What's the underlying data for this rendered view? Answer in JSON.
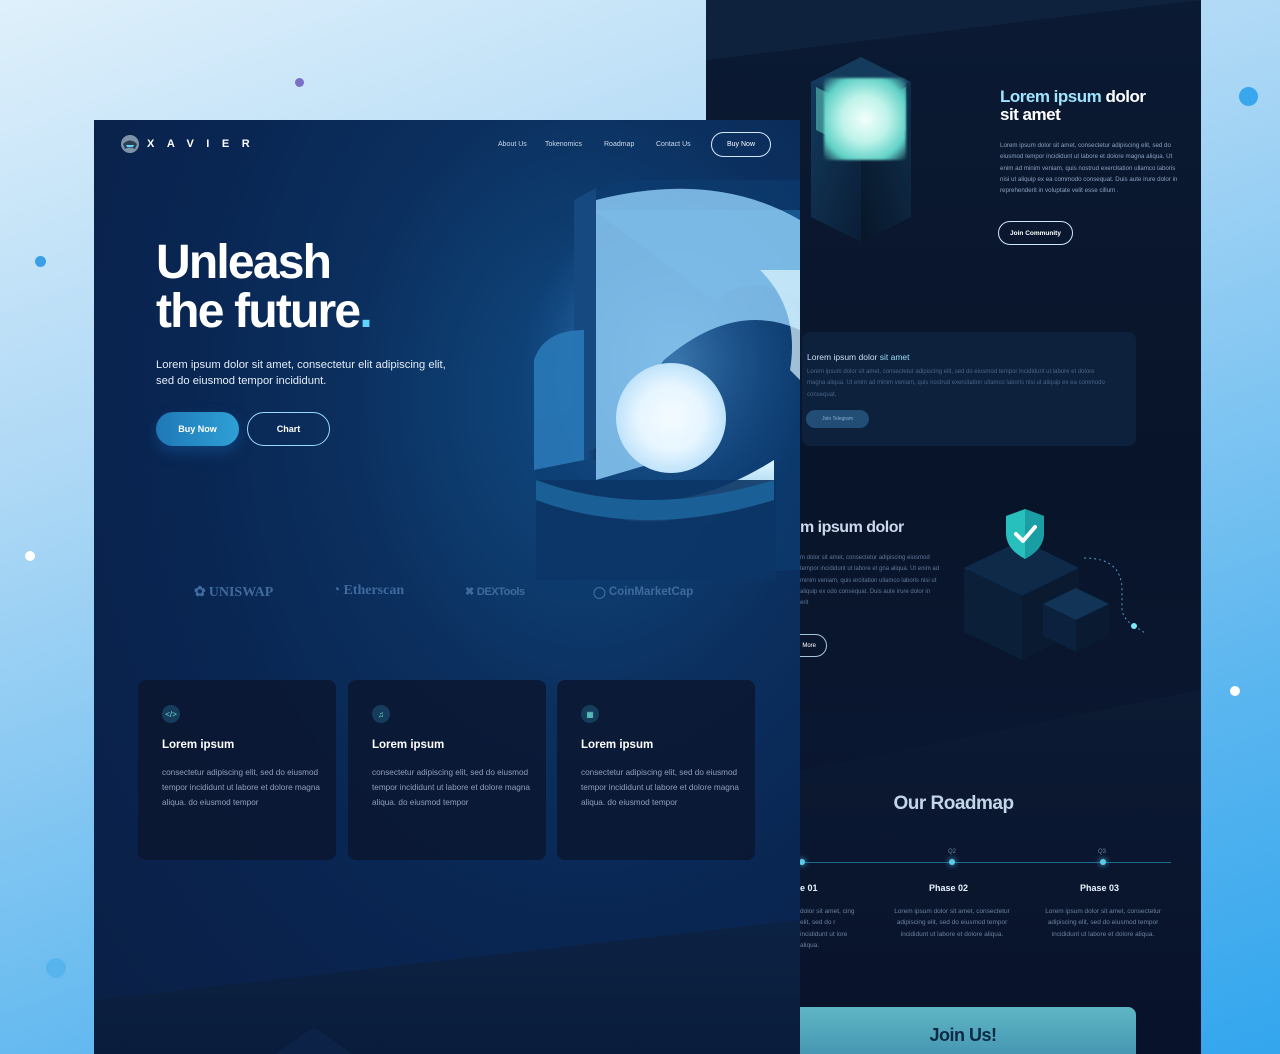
{
  "brand": {
    "name": "XAVIER"
  },
  "nav": {
    "items": [
      "About Us",
      "Tokenomics",
      "Roadmap",
      "Contact Us"
    ],
    "cta": "Buy Now"
  },
  "hero": {
    "title_line1": "Unleash",
    "title_line2": "the future",
    "title_dot": ".",
    "subtitle": "Lorem ipsum dolor sit amet, consectetur elit adipiscing elit, sed do eiusmod tempor incididunt.",
    "primary_button": "Buy Now",
    "secondary_button": "Chart"
  },
  "partners": [
    {
      "name": "UNISWAP",
      "icon": "uniswap-icon"
    },
    {
      "name": "Etherscan",
      "icon": "etherscan-icon"
    },
    {
      "name": "DEXTools",
      "icon": "dextools-icon"
    },
    {
      "name": "CoinMarketCap",
      "icon": "coinmarketcap-icon"
    }
  ],
  "features": [
    {
      "icon": "code-icon",
      "title": "Lorem ipsum",
      "text": "consectetur adipiscing elit, sed do eiusmod tempor incididunt ut  labore et dolore magna aliqua. do eiusmod tempor"
    },
    {
      "icon": "music-note-icon",
      "title": "Lorem ipsum",
      "text": "consectetur adipiscing elit, sed do eiusmod tempor incididunt ut  labore et dolore magna aliqua. do eiusmod tempor"
    },
    {
      "icon": "network-icon",
      "title": "Lorem ipsum",
      "text": "consectetur adipiscing elit, sed do eiusmod tempor incididunt ut  labore et dolore magna aliqua. do eiusmod tempor"
    }
  ],
  "about": {
    "title_highlight": "Lorem ipsum",
    "title_rest1": "dolor",
    "title_line2": "sit amet",
    "text": "Lorem ipsum dolor sit amet, consectetur adipiscing elit, sed do eiusmod tempor incididunt ut labore et dolore magna aliqua. Ut enim ad minim veniam, quis nostrud exercitation ullamco laboris nisi ut aliquip ex ea commodo consequat. Duis aute irure dolor in reprehenderit in voluptate velit esse cillum .",
    "button": "Join Community"
  },
  "telegram_card": {
    "title_a": "Lorem ipsum dolor",
    "title_b": "sit amet",
    "text": "Lorem ipsum dolor sit amet, consectetur adipiscing elit, sed do eiusmod tempor incididunt ut labore et dolore magna aliqua. Ut enim ad minim veniam, quis nostrud exercitation ullamco laboris nisi ut aliquip ex ea commodo consequat.",
    "button": "Join Telegram"
  },
  "security": {
    "title": "m ipsum dolor",
    "text": "m dolor sit amet, consectetur adipiscing eiusmod tempor incididunt ut labore et gna aliqua. Ut enim ad minim veniam, quis ercitation ullamco laboris nisi ut aliquip ex odo consequat. Duis aute irure dolor in erit",
    "button": "More"
  },
  "roadmap": {
    "title": "Our Roadmap",
    "phases": [
      {
        "q": "",
        "name": "e 01",
        "text": "dolor sit amet, cing elit, sed do r incididunt ut lore aliqua."
      },
      {
        "q": "Q2",
        "name": "Phase 02",
        "text": "Lorem ipsum dolor sit amet, consectetur adipiscing elit, sed do eiusmod tempor incididunt ut labore et dolore aliqua."
      },
      {
        "q": "Q3",
        "name": "Phase 03",
        "text": "Lorem ipsum dolor sit amet, consectetur adipiscing elit, sed do eiusmod tempor incididunt ut labore et dolore aliqua."
      }
    ]
  },
  "join": {
    "title": "Join Us!"
  },
  "colors": {
    "accent": "#5fd4ff",
    "panel_dark": "#081429",
    "panel_blue": "#0b2f5e",
    "teal": "#5fc9e8"
  }
}
